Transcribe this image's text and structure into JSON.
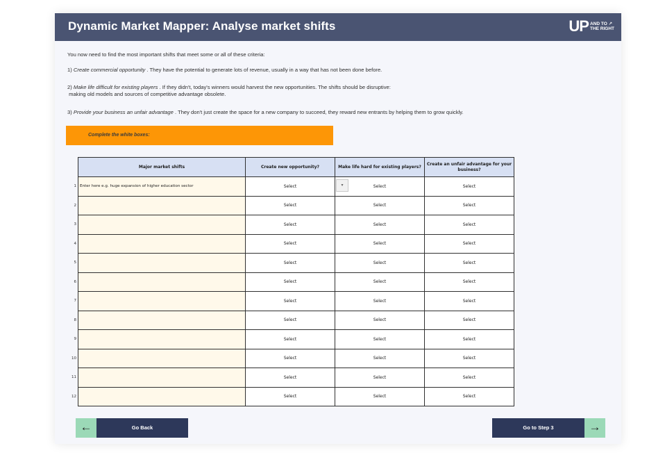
{
  "header": {
    "title": "Dynamic Market Mapper: Analyse market shifts",
    "logo_main": "UP",
    "logo_small_1": "AND TO ↗",
    "logo_small_2": "THE RIGHT"
  },
  "intro": {
    "lead": "You now need to find the most important shifts that meet some or all of these criteria:",
    "c1_num": "1)",
    "c1_italic": "Create commercial opportunity",
    "c1_text": ". They have the potential to generate lots of revenue, usually in a way that has not been done before.",
    "c2_num": "2)",
    "c2_italic": "Make life difficult for existing players",
    "c2_text": ". If they didn't, today's winners would harvest the new opportunities. The shifts should be disruptive:",
    "c2_text2": "making old models and sources of competitive advantage obsolete.",
    "c3_num": "3)",
    "c3_italic": "Provide your business an unfair advantage",
    "c3_text": ". They don't just create the space for a new company to succeed, they reward new entrants by helping them to grow quickly."
  },
  "banner": {
    "label": "Complete the white boxes:"
  },
  "table": {
    "headers": [
      "Major market shifts",
      "Create new opportunity?",
      "Make life hard for existing players?",
      "Create an unfair advantage for your business?"
    ],
    "rows": [
      {
        "num": "1",
        "shift": "Enter here e.g. huge expansion of higher education sector",
        "c1": "Select",
        "c2": "Select",
        "c3": "Select"
      },
      {
        "num": "2",
        "shift": "",
        "c1": "Select",
        "c2": "Select",
        "c3": "Select"
      },
      {
        "num": "3",
        "shift": "",
        "c1": "Select",
        "c2": "Select",
        "c3": "Select"
      },
      {
        "num": "4",
        "shift": "",
        "c1": "Select",
        "c2": "Select",
        "c3": "Select"
      },
      {
        "num": "5",
        "shift": "",
        "c1": "Select",
        "c2": "Select",
        "c3": "Select"
      },
      {
        "num": "6",
        "shift": "",
        "c1": "Select",
        "c2": "Select",
        "c3": "Select"
      },
      {
        "num": "7",
        "shift": "",
        "c1": "Select",
        "c2": "Select",
        "c3": "Select"
      },
      {
        "num": "8",
        "shift": "",
        "c1": "Select",
        "c2": "Select",
        "c3": "Select"
      },
      {
        "num": "9",
        "shift": "",
        "c1": "Select",
        "c2": "Select",
        "c3": "Select"
      },
      {
        "num": "10",
        "shift": "",
        "c1": "Select",
        "c2": "Select",
        "c3": "Select"
      },
      {
        "num": "11",
        "shift": "",
        "c1": "Select",
        "c2": "Select",
        "c3": "Select"
      },
      {
        "num": "12",
        "shift": "",
        "c1": "Select",
        "c2": "Select",
        "c3": "Select"
      }
    ],
    "dropdown_icon": "chevron-down-icon"
  },
  "nav": {
    "back_label": "Go Back",
    "next_label": "Go to Step 3",
    "back_icon": "←",
    "next_icon": "→"
  }
}
